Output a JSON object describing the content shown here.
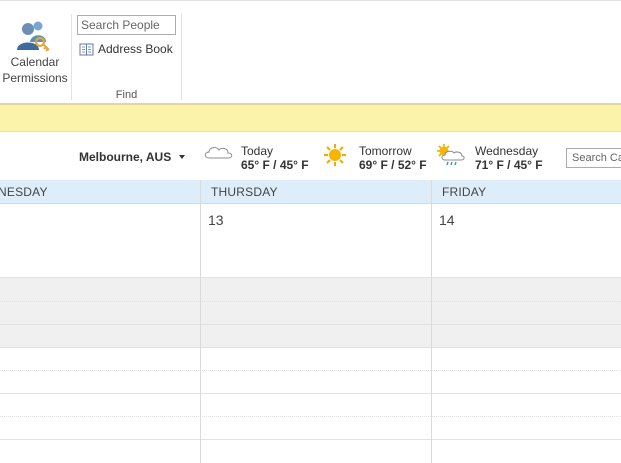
{
  "ribbon": {
    "calendar_permissions": {
      "label_line1": "Calendar",
      "label_line2": "Permissions",
      "icon": "calendar-permissions-icon"
    },
    "find_group": {
      "search_people_placeholder": "Search People",
      "address_book_label": "Address Book",
      "address_book_icon": "address-book-icon",
      "group_label": "Find"
    }
  },
  "weather": {
    "location": "Melbourne, AUS",
    "days": [
      {
        "label": "Today",
        "temps": "65° F / 45° F",
        "icon": "cloudy-icon"
      },
      {
        "label": "Tomorrow",
        "temps": "69° F / 52° F",
        "icon": "sunny-icon"
      },
      {
        "label": "Wednesday",
        "temps": "71° F / 45° F",
        "icon": "sun-rain-icon"
      }
    ]
  },
  "search_calendar_placeholder": "Search Ca",
  "calendar": {
    "days": [
      {
        "name": "NESDAY",
        "date": ""
      },
      {
        "name": "THURSDAY",
        "date": "13"
      },
      {
        "name": "FRIDAY",
        "date": "14"
      }
    ]
  },
  "colors": {
    "info_bar": "#fbf3a9",
    "day_header": "#ddeefa",
    "grey_band": "#f0f0f0"
  }
}
